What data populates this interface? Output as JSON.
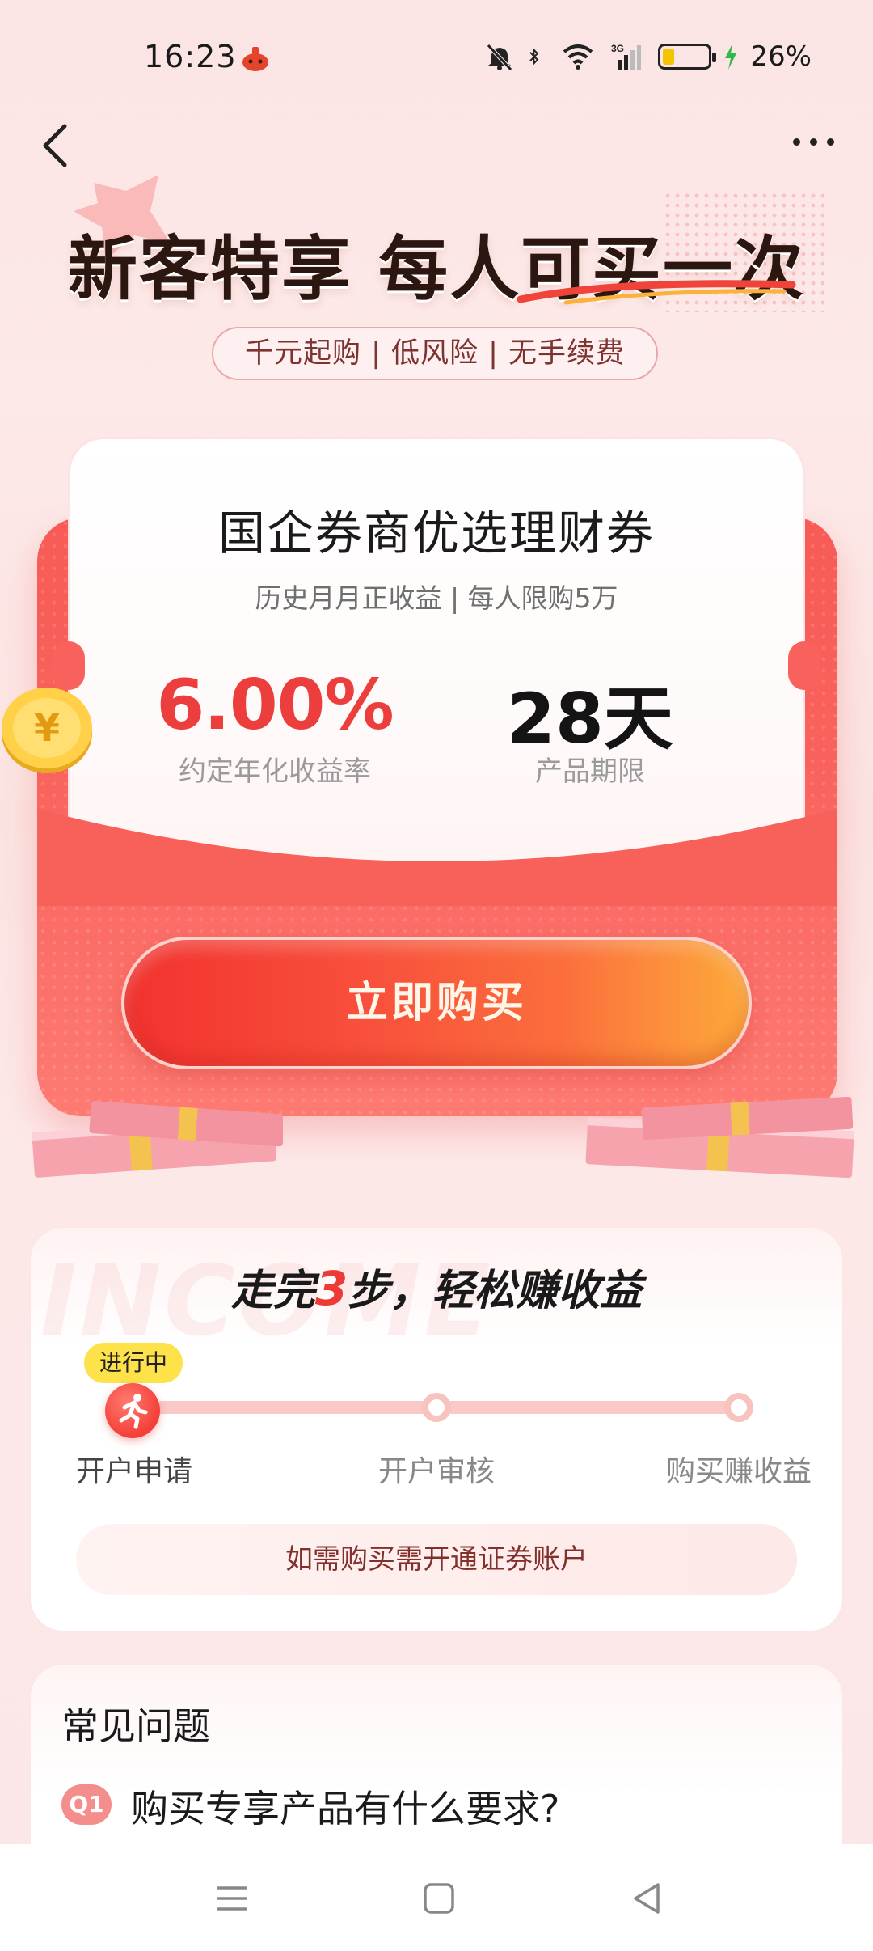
{
  "status_bar": {
    "time": "16:23",
    "network": "3G",
    "battery_percent_text": "26%",
    "battery_level": 0.26,
    "battery_color": "#f5c400",
    "icons": [
      "app-notification-icon",
      "mute-icon",
      "bluetooth-icon",
      "wifi-icon",
      "signal-icon",
      "battery-icon",
      "charging-icon"
    ]
  },
  "top_nav": {
    "back_icon": "chevron-left-icon",
    "more_icon": "more-dots-icon"
  },
  "hero": {
    "title": "新客特享 每人可买一次",
    "tags": "千元起购 | 低风险 | 无手续费"
  },
  "product": {
    "name": "国企券商优选理财券",
    "subtitle": "历史月月正收益 | 每人限购5万",
    "rate_value": "6.00%",
    "rate_label": "约定年化收益率",
    "term_value": "28天",
    "term_label": "产品期限",
    "buy_button": "立即购买"
  },
  "steps": {
    "title_before": "走完",
    "title_number": "3",
    "title_after": "步，轻松赚收益",
    "watermark": "INCOME",
    "current_badge": "进行中",
    "items": [
      {
        "label": "开户申请",
        "state": "current"
      },
      {
        "label": "开户审核",
        "state": "pending"
      },
      {
        "label": "购买赚收益",
        "state": "pending"
      }
    ],
    "note": "如需购买需开通证券账户"
  },
  "faq": {
    "title": "常见问题",
    "items": [
      {
        "badge": "Q1",
        "question": "购买专享产品有什么要求?"
      }
    ]
  },
  "nav_bar": {
    "buttons": [
      "menu-icon",
      "home-icon",
      "back-triangle-icon"
    ]
  },
  "colors": {
    "accent_red": "#ed3a37",
    "rate_red": "#ec3e3c",
    "badge_yellow": "#fde24a",
    "card_red": "#f85b56"
  }
}
